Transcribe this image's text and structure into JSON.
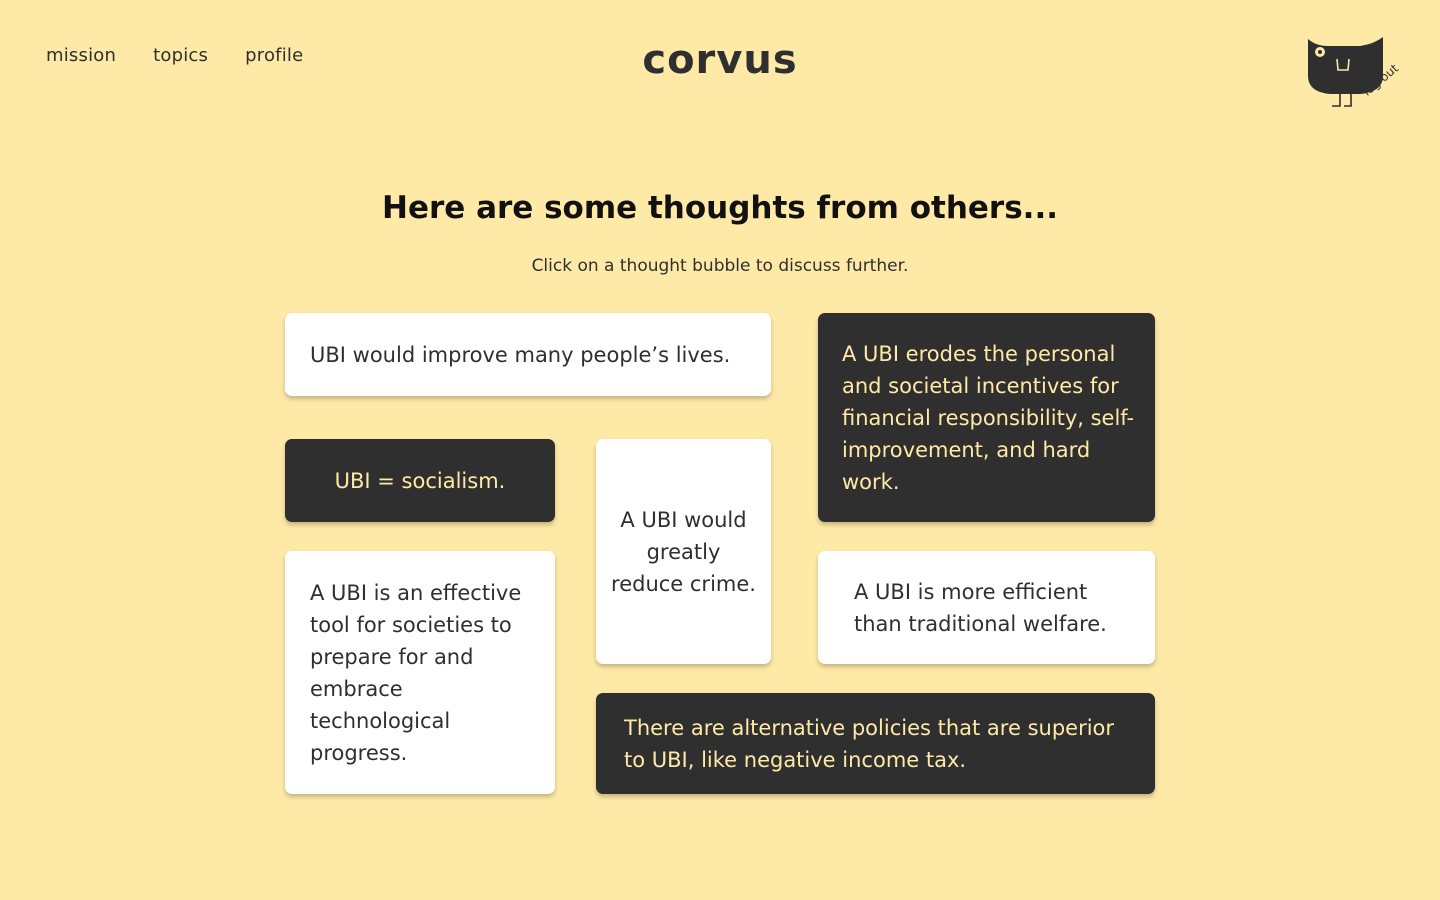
{
  "nav": {
    "items": [
      {
        "label": "mission"
      },
      {
        "label": "topics"
      },
      {
        "label": "profile"
      }
    ]
  },
  "brand": {
    "name": "corvus"
  },
  "account": {
    "logout_label": "log out",
    "avatar_icon": "crow-mascot-icon"
  },
  "content": {
    "heading": "Here are some thoughts from others...",
    "subheading": "Click on a thought bubble to discuss further."
  },
  "thoughts": [
    {
      "text": "UBI would improve many people’s lives.",
      "style": "light"
    },
    {
      "text": "A UBI erodes the personal and societal incentives for financial responsibility, self-improvement, and hard work.",
      "style": "dark"
    },
    {
      "text": "UBI = socialism.",
      "style": "dark"
    },
    {
      "text": "A UBI would greatly reduce crime.",
      "style": "light"
    },
    {
      "text": "A UBI is an effective tool for societies to prepare for and embrace technological progress.",
      "style": "light"
    },
    {
      "text": "A UBI is more efficient than traditional welfare.",
      "style": "light"
    },
    {
      "text": "There are alternative policies that are superior to UBI, like negative income tax.",
      "style": "dark"
    }
  ],
  "colors": {
    "background": "#FFE9A6",
    "dark": "#2F2F2F",
    "light": "#FFFFFF",
    "accent_text": "#FFE9A6"
  }
}
